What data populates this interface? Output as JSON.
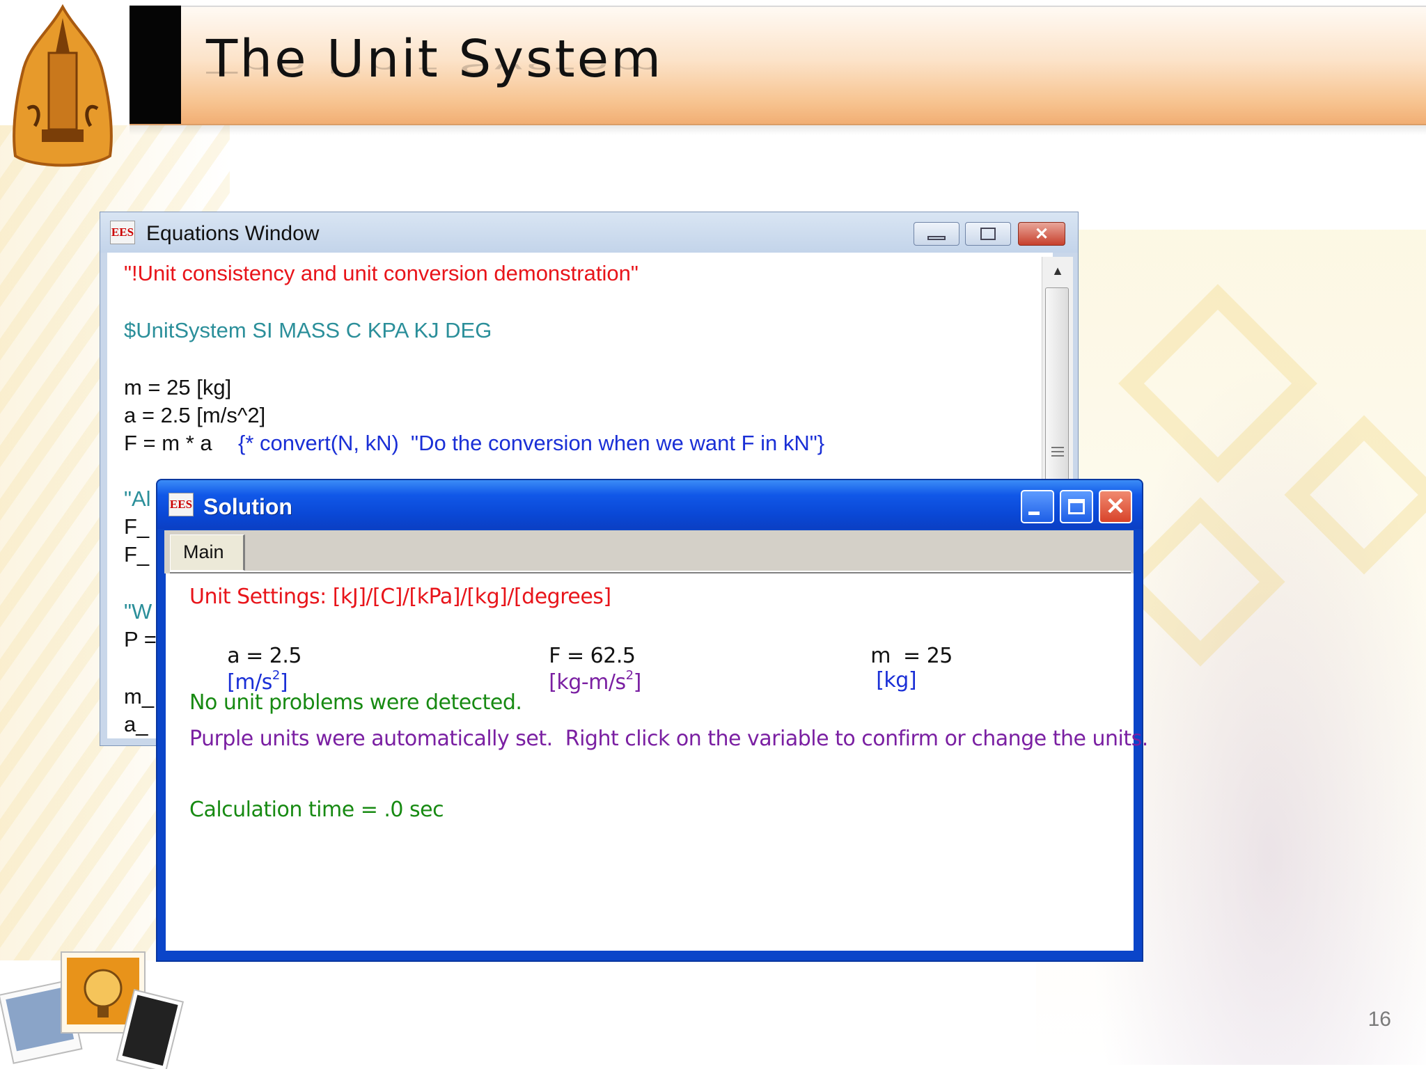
{
  "slide": {
    "title": "The Unit System",
    "page_number": "16"
  },
  "equations_window": {
    "title": "Equations Window",
    "icon_label": "EES",
    "lines": [
      {
        "text": "\"!Unit consistency and unit conversion demonstration\"",
        "color": "#e8141a"
      },
      {
        "text": "$UnitSystem SI MASS C KPA KJ DEG",
        "color": "#2b8f9a"
      },
      {
        "text": "m = 25 [kg]",
        "color": "#111111"
      },
      {
        "text": "a = 2.5 [m/s^2]",
        "color": "#111111"
      },
      {
        "text": "F = m * a",
        "color": "#111111"
      },
      {
        "text": "{* convert(N, kN)  \"Do the conversion when we want F in kN\"}",
        "color": "#1a2fd6"
      },
      {
        "text": "\"Al",
        "color": "#2b8f9a"
      },
      {
        "text": "F_",
        "color": "#111111"
      },
      {
        "text": "F_",
        "color": "#111111"
      },
      {
        "text": "\"W",
        "color": "#2b8f9a"
      },
      {
        "text": "P =",
        "color": "#111111"
      },
      {
        "text": "m_",
        "color": "#111111"
      },
      {
        "text": "a_",
        "color": "#111111"
      }
    ]
  },
  "solution_window": {
    "title": "Solution",
    "icon_label": "EES",
    "tab_label": "Main",
    "unit_settings": "Unit Settings: [kJ]/[C]/[kPa]/[kg]/[degrees]",
    "variables": [
      {
        "name_value": "a = 2.5",
        "unit_base": "[m/s",
        "unit_exp": "2",
        "unit_close": "]",
        "unit_color": "#1a2fd6"
      },
      {
        "name_value": "F = 62.5",
        "unit_base": "[kg-m/s",
        "unit_exp": "2",
        "unit_close": "]",
        "unit_color": "#7a1fa2"
      },
      {
        "name_value": "m  = 25",
        "unit_base": "[kg]",
        "unit_exp": "",
        "unit_close": "",
        "unit_color": "#1a2fd6"
      }
    ],
    "no_problems": "No unit problems were detected.",
    "purple_note": "Purple units were automatically set.  Right click on the variable to confirm or change the units.",
    "calc_time": "Calculation time = .0 sec"
  },
  "colors": {
    "red": "#e8141a",
    "green": "#178a12",
    "purple": "#7a1fa2",
    "blue": "#1a2fd6",
    "teal": "#2b8f9a",
    "xp_blue": "#0b45c9",
    "close_red": "#d8432a"
  }
}
